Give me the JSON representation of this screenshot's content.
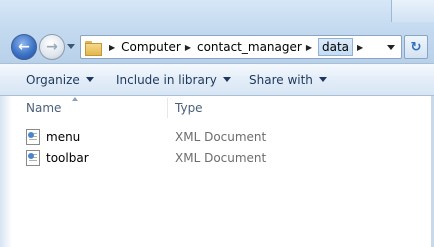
{
  "navigation": {
    "back_icon": "back-arrow-icon",
    "forward_icon": "forward-arrow-icon",
    "refresh_icon": "refresh-icon"
  },
  "address_bar": {
    "crumbs": [
      "Computer",
      "contact_manager",
      "data"
    ]
  },
  "command_bar": {
    "organize": "Organize",
    "include_in_library": "Include in library",
    "share_with": "Share with"
  },
  "columns": {
    "name": "Name",
    "type": "Type"
  },
  "files": [
    {
      "name": "menu",
      "type": "XML Document"
    },
    {
      "name": "toolbar",
      "type": "XML Document"
    }
  ]
}
